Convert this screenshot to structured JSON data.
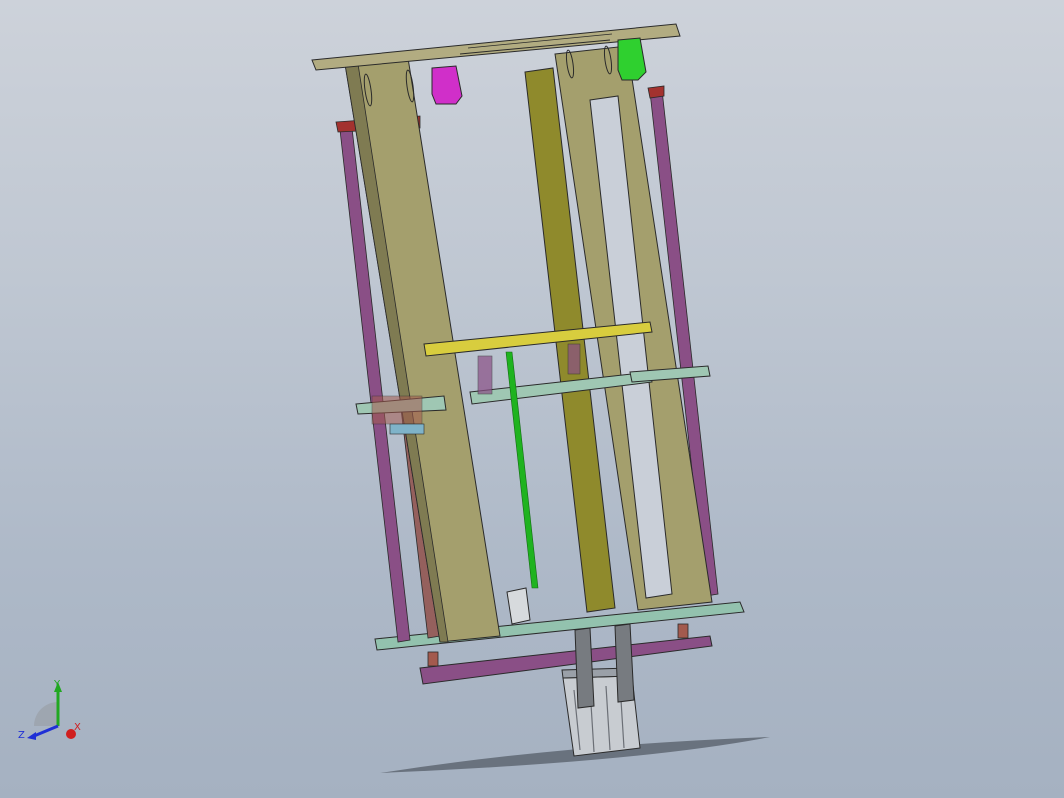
{
  "scene": {
    "colors": {
      "background_top": "#cdd2da",
      "background_bottom": "#a5b1c1",
      "frame_plate": "#a49f6d",
      "back_plate": "#8f8a2c",
      "rods": "#8a4f86",
      "rod_caps_red": "#a3322f",
      "top_plate": "#b2ac81",
      "yellow_plate": "#d8cd3e",
      "teal_plate": "#9fc7b3",
      "green_rod": "#1fb31f",
      "magenta_bracket": "#d02fc9",
      "green_bracket": "#2fd02f",
      "bottom_plate": "#93c2ae",
      "motor": "#c8ccd1",
      "shadow": "#5e6672"
    }
  },
  "triad": {
    "x_label": "X",
    "y_label": "Y",
    "z_label": "Z",
    "x_color": "#d01f1f",
    "y_color": "#21a821",
    "z_color": "#1f2fd6"
  }
}
